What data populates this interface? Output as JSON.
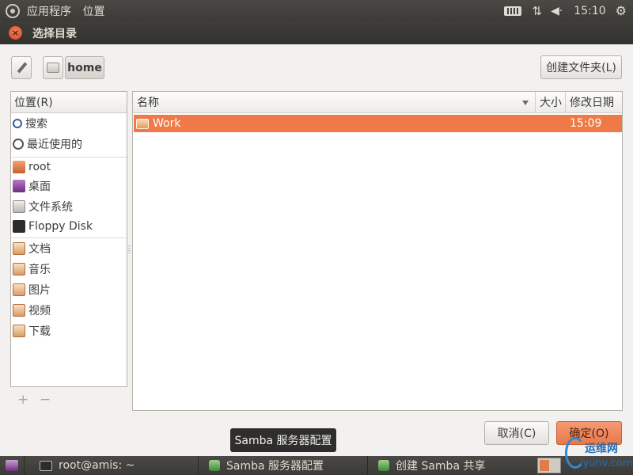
{
  "top_panel": {
    "menu_apps": "应用程序",
    "menu_places": "位置",
    "clock": "15:10",
    "net_glyph": "⇅",
    "volume_glyph": "◀·",
    "gear_glyph": "⚙"
  },
  "dialog": {
    "title": "选择目录",
    "close_glyph": "×",
    "path": {
      "home_label": "home"
    },
    "new_folder_label": "创建文件夹(L)",
    "places": {
      "header": "位置(R)",
      "items": [
        {
          "label": "搜索",
          "icon": "search-icon"
        },
        {
          "label": "最近使用的",
          "icon": "recent-icon"
        },
        {
          "label": "root",
          "icon": "home-folder-icon"
        },
        {
          "label": "桌面",
          "icon": "desktop-icon"
        },
        {
          "label": "文件系统",
          "icon": "filesystem-icon"
        },
        {
          "label": "Floppy Disk",
          "icon": "floppy-icon"
        },
        {
          "label": "文档",
          "icon": "documents-folder-icon"
        },
        {
          "label": "音乐",
          "icon": "music-folder-icon"
        },
        {
          "label": "图片",
          "icon": "pictures-folder-icon"
        },
        {
          "label": "视频",
          "icon": "videos-folder-icon"
        },
        {
          "label": "下载",
          "icon": "downloads-folder-icon"
        }
      ],
      "add_glyph": "+",
      "remove_glyph": "−"
    },
    "files": {
      "columns": {
        "name": "名称",
        "size": "大小",
        "modified": "修改日期"
      },
      "rows": [
        {
          "name": "Work",
          "size": "",
          "modified": "15:09",
          "selected": true
        }
      ]
    },
    "cancel_label": "取消(C)",
    "ok_label": "确定(O)"
  },
  "tooltip": "Samba 服务器配置",
  "taskbar": {
    "tasks": [
      {
        "label": "root@amis: ~",
        "icon": "terminal-icon"
      },
      {
        "label": "Samba 服务器配置",
        "icon": "samba-icon"
      },
      {
        "label": "创建 Samba 共享",
        "icon": "samba-icon"
      }
    ]
  },
  "watermark": {
    "line1": "运维网",
    "line2": "iyunv.com"
  },
  "colors": {
    "accent": "#ef7a47",
    "panel": "#3c3b37",
    "window_bg": "#f2f1f0"
  }
}
